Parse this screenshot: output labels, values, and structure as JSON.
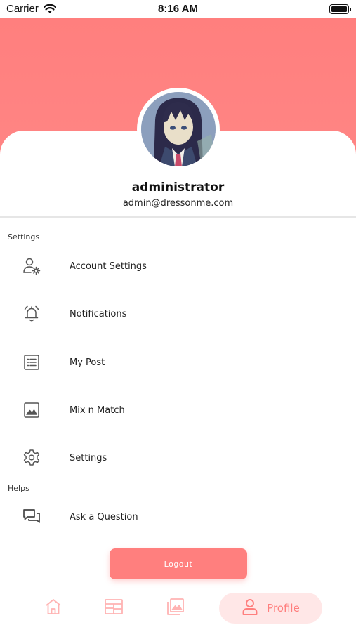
{
  "status_bar": {
    "carrier": "Carrier",
    "time": "8:16 AM"
  },
  "colors": {
    "accent": "#ff7f7e",
    "accent_light": "#ffe7e7",
    "icon_gray": "#555555"
  },
  "profile": {
    "username": "administrator",
    "email": "admin@dressonme.com",
    "avatar_icon": "user-avatar-photo"
  },
  "sections": {
    "settings_label": "Settings",
    "helps_label": "Helps"
  },
  "menu": {
    "account_settings": {
      "label": "Account Settings",
      "icon": "user-gear-icon"
    },
    "notifications": {
      "label": "Notifications",
      "icon": "bell-icon"
    },
    "my_post": {
      "label": "My Post",
      "icon": "list-icon"
    },
    "mix_n_match": {
      "label": "Mix n Match",
      "icon": "image-icon"
    },
    "settings": {
      "label": "Settings",
      "icon": "gear-icon"
    },
    "ask_question": {
      "label": "Ask a Question",
      "icon": "chat-icon"
    }
  },
  "logout": {
    "label": "Logout"
  },
  "bottom_nav": {
    "home_icon": "home-icon",
    "calendar_icon": "calendar-icon",
    "gallery_icon": "gallery-icon",
    "profile_label": "Profile",
    "profile_icon": "person-icon"
  }
}
